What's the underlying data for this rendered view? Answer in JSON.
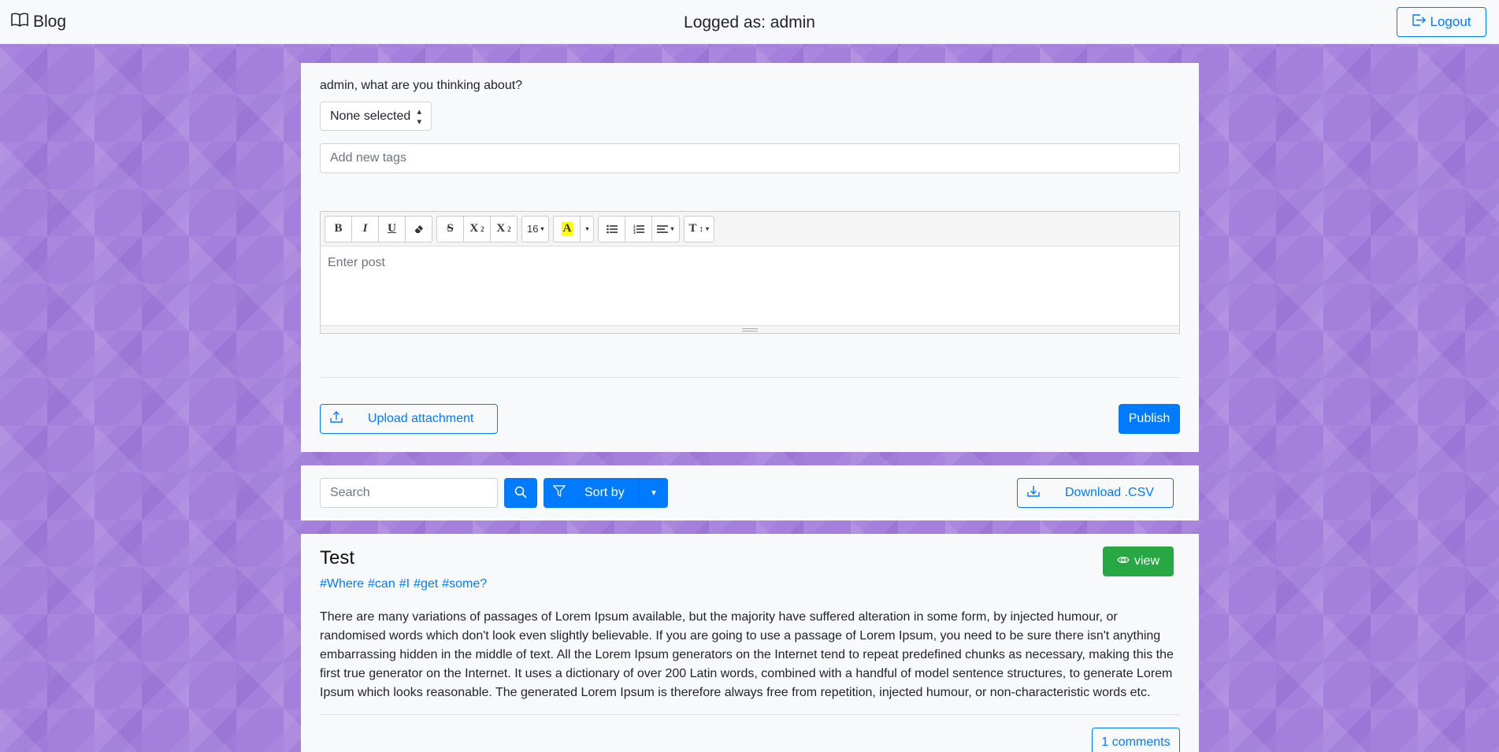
{
  "navbar": {
    "brand": "Blog",
    "brand_icon": "book-icon",
    "logged_as": "Logged as: admin",
    "logout_label": "Logout",
    "logout_icon": "logout-icon"
  },
  "compose": {
    "prompt": "admin, what are you thinking about?",
    "category_select": "None selected",
    "tags_placeholder": "Add new tags",
    "editor": {
      "font_size": "16",
      "placeholder": "Enter post",
      "toolbar_icons": [
        "bold-icon",
        "italic-icon",
        "underline-icon",
        "eraser-icon",
        "strikethrough-icon",
        "superscript-icon",
        "subscript-icon",
        "font-size-dropdown",
        "text-color-icon",
        "color-dropdown",
        "unordered-list-icon",
        "ordered-list-icon",
        "align-dropdown",
        "line-height-dropdown"
      ]
    },
    "upload_label": "Upload attachment",
    "publish_label": "Publish"
  },
  "toolbar": {
    "search_placeholder": "Search",
    "sort_label": "Sort by",
    "csv_label": "Download .CSV"
  },
  "post": {
    "title": "Test",
    "view_label": "view",
    "tags": [
      "#Where",
      "#can",
      "#I",
      "#get",
      "#some?"
    ],
    "body": "There are many variations of passages of Lorem Ipsum available, but the majority have suffered alteration in some form, by injected humour, or randomised words which don't look even slightly believable. If you are going to use a passage of Lorem Ipsum, you need to be sure there isn't anything embarrassing hidden in the middle of text. All the Lorem Ipsum generators on the Internet tend to repeat predefined chunks as necessary, making this the first true generator on the Internet. It uses a dictionary of over 200 Latin words, combined with a handful of model sentence structures, to generate Lorem Ipsum which looks reasonable. The generated Lorem Ipsum is therefore always free from repetition, injected humour, or non-characteristic words etc.",
    "comments_label": "1 comments"
  },
  "colors": {
    "primary": "#007bff",
    "success": "#28a745",
    "background": "#a57fdc",
    "card": "#f8f9fa"
  }
}
